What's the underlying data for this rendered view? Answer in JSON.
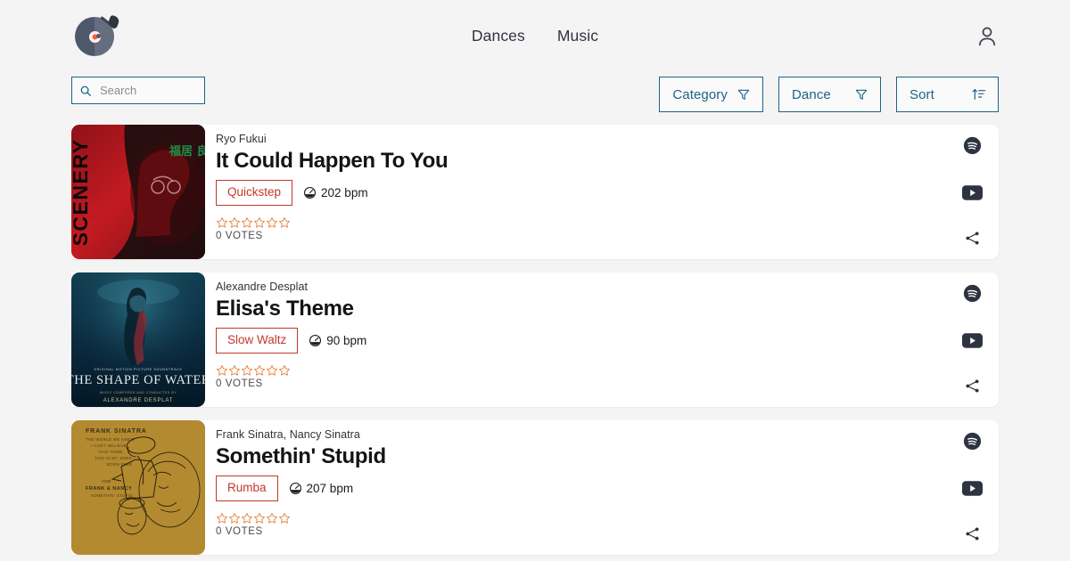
{
  "header": {
    "logo_name": "vinyl-record-logo",
    "nav": [
      {
        "label": "Dances",
        "name": "nav-link-dances"
      },
      {
        "label": "Music",
        "name": "nav-link-music"
      }
    ],
    "account_icon": "person-icon"
  },
  "filterbar": {
    "search": {
      "placeholder": "Search",
      "value": "",
      "icon": "search-icon"
    },
    "buttons": [
      {
        "label": "Category",
        "icon": "filter-funnel-icon"
      },
      {
        "label": "Dance",
        "icon": "filter-funnel-icon"
      },
      {
        "label": "Sort",
        "icon": "sort-ascending-icon"
      }
    ]
  },
  "colors": {
    "page_background": "#f4f4f4",
    "card_background": "#ffffff",
    "accent_teal": "#1c6487",
    "dance_tag_red": "#c0392b",
    "star_orange": "#e8813c",
    "icon_dark": "#2d3340"
  },
  "songs": [
    {
      "artist": "Ryo Fukui",
      "title": "It Could Happen To You",
      "dance": "Quickstep",
      "bpm": "202 bpm",
      "rating": 0,
      "stars_total": 6,
      "votes": "0 VOTES",
      "album_art": {
        "name": "album-art-scenery",
        "title_text": "SCENERY",
        "secondary_text": "福居 良",
        "background": "#b01820",
        "accent": "#1c1a18"
      },
      "actions": [
        "spotify-icon",
        "youtube-icon",
        "share-icon"
      ]
    },
    {
      "artist": "Alexandre Desplat",
      "title": "Elisa's Theme",
      "dance": "Slow Waltz",
      "bpm": "90 bpm",
      "rating": 0,
      "stars_total": 6,
      "votes": "0 VOTES",
      "album_art": {
        "name": "album-art-shape-of-water",
        "title_text": "THE SHAPE OF WATER",
        "secondary_text": "ALEXANDRE DESPLAT",
        "background": "#0d3246",
        "accent": "#d8c28a"
      },
      "actions": [
        "spotify-icon",
        "youtube-icon",
        "share-icon"
      ]
    },
    {
      "artist": "Frank Sinatra, Nancy Sinatra",
      "title": "Somethin' Stupid",
      "dance": "Rumba",
      "bpm": "207 bpm",
      "rating": 0,
      "stars_total": 6,
      "votes": "0 VOTES",
      "album_art": {
        "name": "album-art-frank-sinatra",
        "title_text": "FRANK SINATRA",
        "secondary_text": "SOMETHIN' STUPID",
        "background": "#b98f33",
        "accent": "#3b2d16"
      },
      "actions": [
        "spotify-icon",
        "youtube-icon",
        "share-icon"
      ]
    }
  ]
}
